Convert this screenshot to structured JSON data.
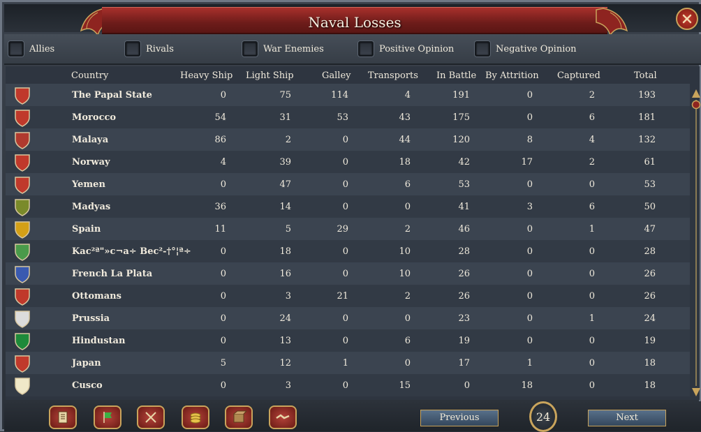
{
  "window": {
    "title": "Naval Losses"
  },
  "filters": [
    {
      "label": "Allies"
    },
    {
      "label": "Rivals"
    },
    {
      "label": "War Enemies"
    },
    {
      "label": "Positive Opinion"
    },
    {
      "label": "Negative Opinion"
    }
  ],
  "columns": {
    "country": "Country",
    "heavy": "Heavy Ship",
    "light": "Light Ship",
    "galley": "Galley",
    "transports": "Transports",
    "battle": "In Battle",
    "attrition": "By Attrition",
    "captured": "Captured",
    "total": "Total"
  },
  "rows": [
    {
      "country": "The Papal State",
      "heavy": "0",
      "light": "75",
      "galley": "114",
      "transports": "4",
      "battle": "191",
      "attrition": "0",
      "captured": "2",
      "total": "193",
      "color": "#c0392b"
    },
    {
      "country": "Morocco",
      "heavy": "54",
      "light": "31",
      "galley": "53",
      "transports": "43",
      "battle": "175",
      "attrition": "0",
      "captured": "6",
      "total": "181",
      "color": "#c0392b"
    },
    {
      "country": "Malaya",
      "heavy": "86",
      "light": "2",
      "galley": "0",
      "transports": "44",
      "battle": "120",
      "attrition": "8",
      "captured": "4",
      "total": "132",
      "color": "#b03a2e"
    },
    {
      "country": "Norway",
      "heavy": "4",
      "light": "39",
      "galley": "0",
      "transports": "18",
      "battle": "42",
      "attrition": "17",
      "captured": "2",
      "total": "61",
      "color": "#c0392b"
    },
    {
      "country": "Yemen",
      "heavy": "0",
      "light": "47",
      "galley": "0",
      "transports": "6",
      "battle": "53",
      "attrition": "0",
      "captured": "0",
      "total": "53",
      "color": "#c0392b"
    },
    {
      "country": "Madyas",
      "heavy": "36",
      "light": "14",
      "galley": "0",
      "transports": "0",
      "battle": "41",
      "attrition": "3",
      "captured": "6",
      "total": "50",
      "color": "#7a8a2a"
    },
    {
      "country": "Spain",
      "heavy": "11",
      "light": "5",
      "galley": "29",
      "transports": "2",
      "battle": "46",
      "attrition": "0",
      "captured": "1",
      "total": "47",
      "color": "#d4a017"
    },
    {
      "country": "Kac²ª\"»c¬a÷ Bec²-†°¦ª÷",
      "heavy": "0",
      "light": "18",
      "galley": "0",
      "transports": "10",
      "battle": "28",
      "attrition": "0",
      "captured": "0",
      "total": "28",
      "color": "#4a9a4a"
    },
    {
      "country": "French La Plata",
      "heavy": "0",
      "light": "16",
      "galley": "0",
      "transports": "10",
      "battle": "26",
      "attrition": "0",
      "captured": "0",
      "total": "26",
      "color": "#3a5ab0"
    },
    {
      "country": "Ottomans",
      "heavy": "0",
      "light": "3",
      "galley": "21",
      "transports": "2",
      "battle": "26",
      "attrition": "0",
      "captured": "0",
      "total": "26",
      "color": "#c0392b"
    },
    {
      "country": "Prussia",
      "heavy": "0",
      "light": "24",
      "galley": "0",
      "transports": "0",
      "battle": "23",
      "attrition": "0",
      "captured": "1",
      "total": "24",
      "color": "#dcdcdc"
    },
    {
      "country": "Hindustan",
      "heavy": "0",
      "light": "13",
      "galley": "0",
      "transports": "6",
      "battle": "19",
      "attrition": "0",
      "captured": "0",
      "total": "19",
      "color": "#1e8a3a"
    },
    {
      "country": "Japan",
      "heavy": "5",
      "light": "12",
      "galley": "1",
      "transports": "0",
      "battle": "17",
      "attrition": "1",
      "captured": "0",
      "total": "18",
      "color": "#c0392b"
    },
    {
      "country": "Cusco",
      "heavy": "0",
      "light": "3",
      "galley": "0",
      "transports": "15",
      "battle": "0",
      "attrition": "18",
      "captured": "0",
      "total": "18",
      "color": "#f0e8c8"
    }
  ],
  "bottom": {
    "icons": [
      "ledger-icon",
      "flag-icon",
      "crossed-swords-icon",
      "coins-icon",
      "crate-icon",
      "handshake-icon"
    ],
    "previous_label": "Previous",
    "page_number": "24",
    "next_label": "Next"
  }
}
